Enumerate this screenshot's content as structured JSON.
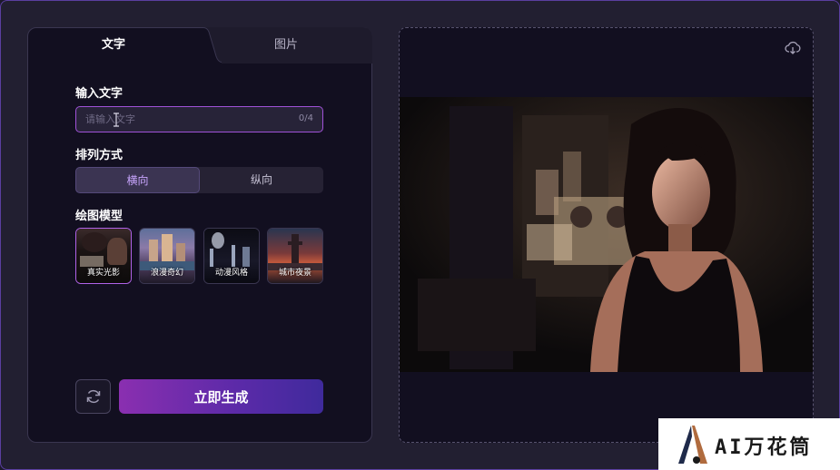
{
  "tabs": {
    "text": "文字",
    "image": "图片"
  },
  "input_section": {
    "label": "输入文字",
    "placeholder": "请输入文字",
    "counter": "0/4"
  },
  "layout_section": {
    "label": "排列方式",
    "options": [
      "横向",
      "纵向"
    ],
    "selected": "横向"
  },
  "model_section": {
    "label": "绘图模型",
    "models": [
      {
        "name": "真实光影",
        "selected": true
      },
      {
        "name": "浪漫奇幻",
        "selected": false
      },
      {
        "name": "动漫风格",
        "selected": false
      },
      {
        "name": "城市夜景",
        "selected": false
      }
    ]
  },
  "actions": {
    "refresh_icon": "refresh-icon",
    "generate_label": "立即生成"
  },
  "preview": {
    "download_icon": "cloud-download-icon"
  },
  "watermark": {
    "text": "AI万花筒"
  },
  "colors": {
    "accent_purple": "#a052d8",
    "generate_gradient_start": "#8a2fb0",
    "generate_gradient_end": "#3f2a9c",
    "panel_bg": "#120f20",
    "page_bg": "#221f31"
  }
}
